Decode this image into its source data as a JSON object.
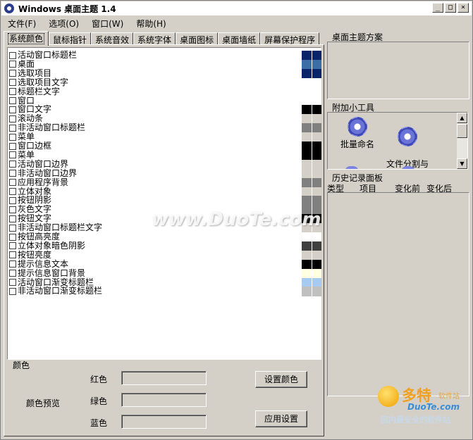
{
  "window": {
    "title": "Windows 桌面主题 1.4",
    "minimize": "_",
    "maximize": "□",
    "close": "×"
  },
  "menu": [
    "文件(F)",
    "选项(O)",
    "窗口(W)",
    "帮助(H)"
  ],
  "tabs": [
    "系统颜色",
    "鼠标指针",
    "系统音效",
    "系统字体",
    "桌面图标",
    "桌面墙纸",
    "屏幕保护程序"
  ],
  "color_items": [
    {
      "label": "活动窗口标题栏",
      "c1": "#0a246a",
      "c2": "#0a246a"
    },
    {
      "label": "桌面",
      "c1": "#3a6ea5",
      "c2": "#3a6ea5"
    },
    {
      "label": "选取项目",
      "c1": "#0a246a",
      "c2": "#0a246a"
    },
    {
      "label": "选取项目文字",
      "c1": "#ffffff",
      "c2": "#ffffff"
    },
    {
      "label": "标题栏文字",
      "c1": "#ffffff",
      "c2": "#ffffff"
    },
    {
      "label": "窗口",
      "c1": "#ffffff",
      "c2": "#ffffff"
    },
    {
      "label": "窗口文字",
      "c1": "#000000",
      "c2": "#000000"
    },
    {
      "label": "滚动条",
      "c1": "#d4d0c8",
      "c2": "#d4d0c8"
    },
    {
      "label": "非活动窗口标题栏",
      "c1": "#808080",
      "c2": "#808080"
    },
    {
      "label": "菜单",
      "c1": "#d4d0c8",
      "c2": "#d4d0c8"
    },
    {
      "label": "窗口边框",
      "c1": "#000000",
      "c2": "#000000"
    },
    {
      "label": "菜单",
      "c1": "#000000",
      "c2": "#000000"
    },
    {
      "label": "活动窗口边界",
      "c1": "#d4d0c8",
      "c2": "#d4d0c8"
    },
    {
      "label": "非活动窗口边界",
      "c1": "#d4d0c8",
      "c2": "#d4d0c8"
    },
    {
      "label": "应用程序背景",
      "c1": "#808080",
      "c2": "#808080"
    },
    {
      "label": "立体对象",
      "c1": "#d4d0c8",
      "c2": "#d4d0c8"
    },
    {
      "label": "按钮阴影",
      "c1": "#808080",
      "c2": "#808080"
    },
    {
      "label": "灰色文字",
      "c1": "#808080",
      "c2": "#808080"
    },
    {
      "label": "按钮文字",
      "c1": "#000000",
      "c2": "#000000"
    },
    {
      "label": "非活动窗口标题栏文字",
      "c1": "#d4d0c8",
      "c2": "#d4d0c8"
    },
    {
      "label": "按钮高亮度",
      "c1": "#ffffff",
      "c2": "#ffffff"
    },
    {
      "label": "立体对象暗色阴影",
      "c1": "#404040",
      "c2": "#404040"
    },
    {
      "label": "按钮亮度",
      "c1": "#d4d0c8",
      "c2": "#d4d0c8"
    },
    {
      "label": "提示信息文本",
      "c1": "#000000",
      "c2": "#000000"
    },
    {
      "label": "提示信息窗口背景",
      "c1": "#ffffe1",
      "c2": "#ffffe1"
    },
    {
      "label": "活动窗口渐变标题栏",
      "c1": "#a6caf0",
      "c2": "#a6caf0"
    },
    {
      "label": "非活动窗口渐变标题栏",
      "c1": "#c0c0c0",
      "c2": "#c0c0c0"
    }
  ],
  "color_panel": {
    "group_label": "颜色",
    "preview_label": "颜色预览",
    "red_label": "红色",
    "green_label": "绿色",
    "blue_label": "蓝色",
    "set_color_button": "设置颜色",
    "apply_button": "应用设置"
  },
  "right": {
    "theme_scheme_title": "桌面主题方案",
    "addon_title": "附加小工具",
    "gadgets": [
      "批量命名",
      "文件分割与\n合并"
    ],
    "history_title": "历史记录面板",
    "history_columns": [
      "类型",
      "项目",
      "变化前",
      "变化后"
    ]
  },
  "watermark": "www.DuoTe.com",
  "logo": {
    "main": "多特",
    "soft": "软件站",
    "sub": "DuoTe.com",
    "tagline": "国内最安全的软件站"
  }
}
